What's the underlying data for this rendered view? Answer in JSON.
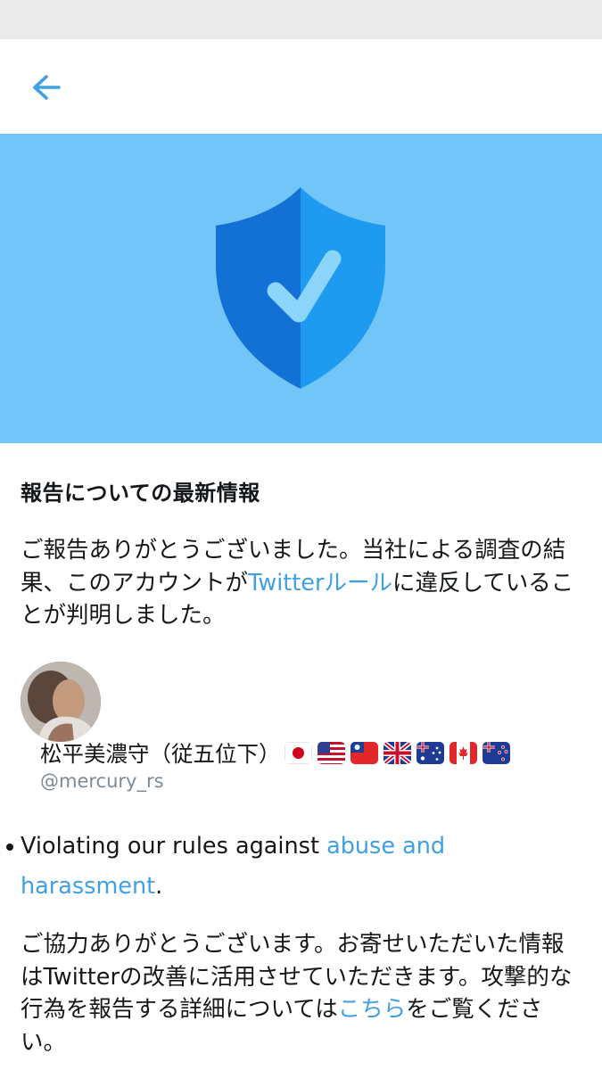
{
  "header": {
    "back_icon": "arrow-left-icon",
    "accent_color": "#3fa0e3"
  },
  "hero": {
    "background": "#71c5f7",
    "icon": "shield-check-icon"
  },
  "report": {
    "heading": "報告についての最新情報",
    "intro_before_link": "ご報告ありがとうございました。当社による調査の結果、このアカウントが",
    "rules_link": "Twitterルール",
    "intro_after_link": "に違反していることが判明しました。"
  },
  "account": {
    "display_name": "松平美濃守（従五位下）",
    "flags": [
      "Japan",
      "United States",
      "Taiwan",
      "United Kingdom",
      "Australia",
      "Canada",
      "New Zealand"
    ],
    "handle": "@mercury_rs"
  },
  "violation": {
    "text_before_link": "Violating our rules against ",
    "link": "abuse and harassment",
    "text_after_link": "."
  },
  "closing": {
    "text_before_link": "ご協力ありがとうございます。お寄せいただいた情報はTwitterの改善に活用させていただきます。攻撃的な行為を報告する詳細については",
    "link": "こちら",
    "text_after_link": "をご覧ください。"
  }
}
